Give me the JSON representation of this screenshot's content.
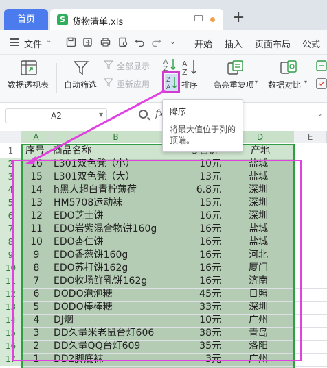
{
  "tabs": {
    "home_label": "首页",
    "file_name": "货物清单.xls",
    "file_icon_letter": "S",
    "new_tab_symbol": "+"
  },
  "menu": {
    "file_label": "文件",
    "tabs": [
      "开始",
      "插入",
      "页面布局",
      "公式"
    ]
  },
  "ribbon": {
    "pivot_label": "数据透视表",
    "autofilter_label": "自动筛选",
    "show_all_label": "全部显示",
    "reapply_label": "重新应用",
    "sort_label": "排序",
    "highlight_dup_label": "高亮重复项",
    "data_compare_label": "数据对比"
  },
  "formula_bar": {
    "cell_ref": "A2",
    "fx_label": "fx"
  },
  "tooltip": {
    "title": "降序",
    "description": "将最大值位于列的顶端。"
  },
  "grid": {
    "columns": [
      "A",
      "B",
      "C",
      "D",
      "E"
    ],
    "header_row": {
      "row_num": "1",
      "a": "序号",
      "b": "商品名称",
      "c": "零售价",
      "d": "产地"
    },
    "rows": [
      {
        "row_num": "2",
        "a": "16",
        "b": "L301双色凳（小）",
        "c": "10元",
        "d": "盐城"
      },
      {
        "row_num": "3",
        "a": "15",
        "b": "L301双色凳（大）",
        "c": "13元",
        "d": "盐城"
      },
      {
        "row_num": "4",
        "a": "14",
        "b": "h黑人超白青柠薄荷",
        "c": "6.8元",
        "d": "深圳"
      },
      {
        "row_num": "5",
        "a": "13",
        "b": "HM5708运动袜",
        "c": "15元",
        "d": "深圳"
      },
      {
        "row_num": "6",
        "a": "12",
        "b": "EDO芝士饼",
        "c": "16元",
        "d": "深圳"
      },
      {
        "row_num": "7",
        "a": "11",
        "b": "EDO岩紫混合物饼160g",
        "c": "16元",
        "d": "盐城"
      },
      {
        "row_num": "8",
        "a": "10",
        "b": "EDO杏仁饼",
        "c": "16元",
        "d": "盐城"
      },
      {
        "row_num": "9",
        "a": "9",
        "b": "EDO香葱饼160g",
        "c": "16元",
        "d": "河北"
      },
      {
        "row_num": "10",
        "a": "8",
        "b": "EDO苏打饼162g",
        "c": "16元",
        "d": "厦门"
      },
      {
        "row_num": "11",
        "a": "7",
        "b": "EDO牧场鲜乳饼162g",
        "c": "16元",
        "d": "济南"
      },
      {
        "row_num": "12",
        "a": "6",
        "b": "DODO泡泡糖",
        "c": "45元",
        "d": "日照"
      },
      {
        "row_num": "13",
        "a": "5",
        "b": "DODO棒棒糖",
        "c": "33元",
        "d": "深圳"
      },
      {
        "row_num": "14",
        "a": "4",
        "b": "DJ烟",
        "c": "10元",
        "d": "广州"
      },
      {
        "row_num": "15",
        "a": "3",
        "b": "DD久量米老鼠台灯606",
        "c": "38元",
        "d": "青岛"
      },
      {
        "row_num": "16",
        "a": "2",
        "b": "DD久量QQ台灯609",
        "c": "35元",
        "d": "洛阳"
      },
      {
        "row_num": "17",
        "a": "1",
        "b": "DD2脚底袜",
        "c": "3元",
        "d": "广州"
      }
    ]
  },
  "colors": {
    "accent_blue": "#4b7bec",
    "selection_green": "#2f9e44",
    "highlight_magenta": "#e041e0"
  }
}
